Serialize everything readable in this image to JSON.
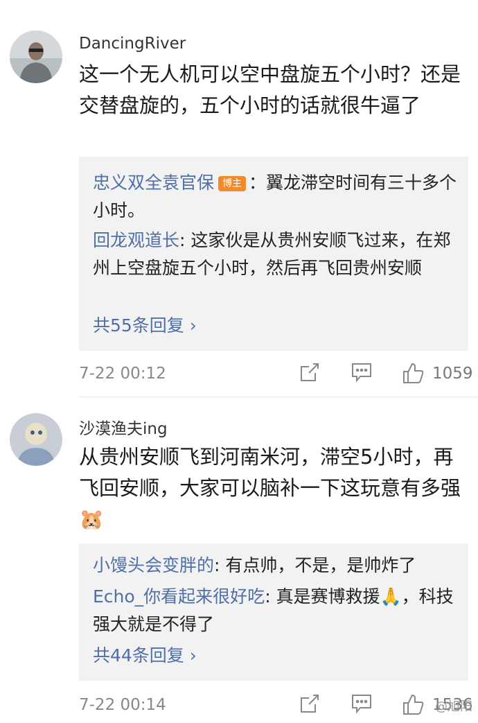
{
  "comments": [
    {
      "username": "DancingRiver",
      "text": "这一个无人机可以空中盘旋五个小时？还是交替盘旋的，五个小时的话就很牛逼了",
      "replies": [
        {
          "name": "忠义双全袁官保",
          "badge": "博主",
          "text": "：翼龙滞空时间有三十多个小时。"
        },
        {
          "name": "回龙观道长",
          "text": ": 这家伙是从贵州安顺飞过来，在郑州上空盘旋五个小时，然后再飞回贵州安顺"
        }
      ],
      "more_label": "共55条回复 ›",
      "time": "7-22 00:12",
      "likes": "1059"
    },
    {
      "username": "沙漠渔夫ing",
      "text": "从贵州安顺飞到河南米河，滞空5小时，再飞回安顺，大家可以脑补一下这玩意有多强",
      "emoji": "🐹",
      "replies": [
        {
          "name": "小馒头会变胖的",
          "text": ": 有点帅，不是，是帅炸了"
        },
        {
          "name": "Echo_你看起来很好吃",
          "text": ": 真是赛博救援🙏，科技强大就是不得了"
        }
      ],
      "more_label": "共44条回复 ›",
      "time": "7-22 00:14",
      "likes": "1536"
    }
  ],
  "watermark": "@旭阳",
  "icons": [
    "share-icon",
    "comment-icon",
    "like-icon"
  ]
}
